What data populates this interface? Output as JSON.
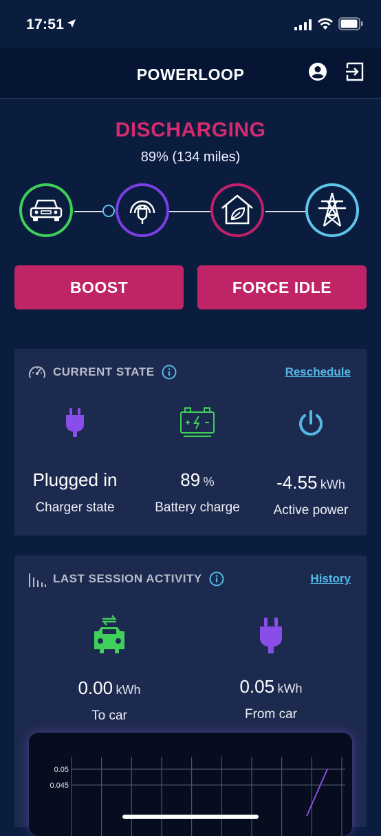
{
  "status_bar": {
    "time": "17:51"
  },
  "header": {
    "title": "POWERLOOP",
    "profile_icon": "account-circle-icon",
    "logout_icon": "logout-icon"
  },
  "status": {
    "title": "DISCHARGING",
    "subtitle": "89% (134 miles)"
  },
  "flow": {
    "nodes": [
      {
        "icon": "car-icon",
        "color": "#3fcf5a"
      },
      {
        "icon": "charger-plug-icon",
        "color": "#7b3fe4"
      },
      {
        "icon": "eco-home-icon",
        "color": "#c21f6a"
      },
      {
        "icon": "power-grid-tower-icon",
        "color": "#5ec4ea"
      }
    ]
  },
  "actions": {
    "boost": "BOOST",
    "force_idle": "FORCE IDLE"
  },
  "current_state": {
    "title": "CURRENT STATE",
    "link": "Reschedule",
    "items": [
      {
        "value": "Plugged in",
        "unit": "",
        "label": "Charger state",
        "icon": "plug-icon"
      },
      {
        "value": "89",
        "unit": "%",
        "label": "Battery charge",
        "icon": "battery-icon"
      },
      {
        "value": "-4.55",
        "unit": "kWh",
        "label": "Active power",
        "icon": "power-icon"
      }
    ]
  },
  "last_session": {
    "title": "LAST SESSION ACTIVITY",
    "link": "History",
    "items": [
      {
        "value": "0.00",
        "unit": "kWh",
        "label": "To car",
        "icon": "car-charging-icon"
      },
      {
        "value": "0.05",
        "unit": "kWh",
        "label": "From car",
        "icon": "plug-icon"
      }
    ]
  },
  "colors": {
    "accent": "#bf2566",
    "link": "#52b9e6",
    "background": "#0b1d3f",
    "card": "#1d2a4f"
  },
  "chart_data": {
    "type": "line",
    "title": "",
    "xlabel": "",
    "ylabel": "",
    "ytick_labels": [
      "0.05",
      "0.045"
    ],
    "ylim": [
      0.04,
      0.05
    ],
    "grid": true,
    "series": [
      {
        "values": [
          0.04,
          0.05
        ]
      }
    ]
  }
}
